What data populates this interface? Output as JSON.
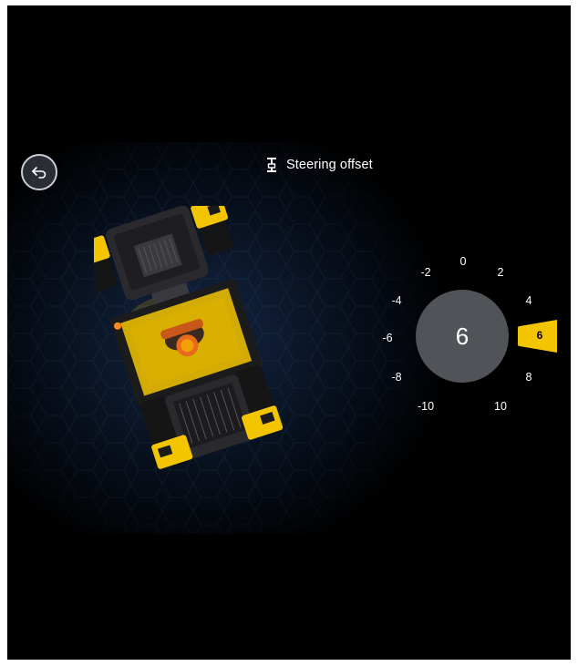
{
  "header": {
    "title": "Steering offset",
    "icon": "steering-offset-icon"
  },
  "back_button": {
    "icon": "back-arrow-icon"
  },
  "dial": {
    "current_value": "6",
    "selected_marker": "6",
    "ticks": [
      "-10",
      "-8",
      "-6",
      "-4",
      "-2",
      "0",
      "2",
      "4",
      "6",
      "8",
      "10"
    ],
    "accent_color": "#f2c500",
    "center_color": "#505357"
  },
  "machine": {
    "body_color": "#f2c500",
    "operator_color": "#e86a1c"
  }
}
